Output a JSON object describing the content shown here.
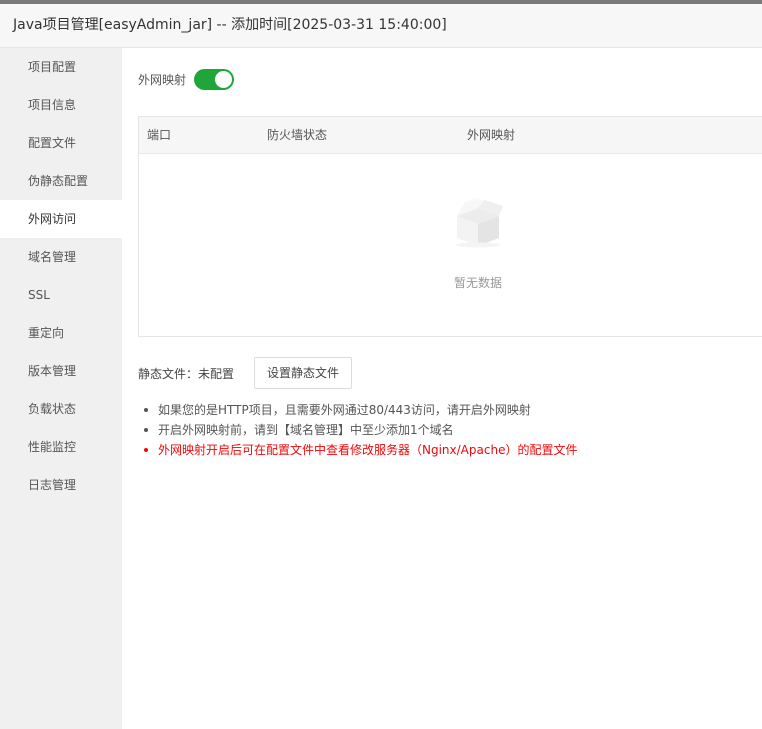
{
  "window": {
    "title": "Java项目管理[easyAdmin_jar] -- 添加时间[2025-03-31 15:40:00]"
  },
  "sidebar": {
    "items": [
      {
        "label": "项目配置"
      },
      {
        "label": "项目信息"
      },
      {
        "label": "配置文件"
      },
      {
        "label": "伪静态配置"
      },
      {
        "label": "外网访问",
        "active": true
      },
      {
        "label": "域名管理"
      },
      {
        "label": "SSL"
      },
      {
        "label": "重定向"
      },
      {
        "label": "版本管理"
      },
      {
        "label": "负载状态"
      },
      {
        "label": "性能监控"
      },
      {
        "label": "日志管理"
      }
    ]
  },
  "main": {
    "toggle_label": "外网映射",
    "toggle_on": true,
    "table": {
      "headers": [
        "端口",
        "防火墙状态",
        "外网映射"
      ],
      "empty_text": "暂无数据"
    },
    "static_label": "静态文件：未配置",
    "static_button": "设置静态文件",
    "tips": [
      "如果您的是HTTP项目，且需要外网通过80/443访问，请开启外网映射",
      "开启外网映射前，请到【域名管理】中至少添加1个域名",
      "外网映射开启后可在配置文件中查看修改服务器（Nginx/Apache）的配置文件"
    ]
  },
  "colors": {
    "accent": "#20a53a",
    "warning": "#ef0808",
    "sidebar_bg": "#f0f0f0"
  }
}
